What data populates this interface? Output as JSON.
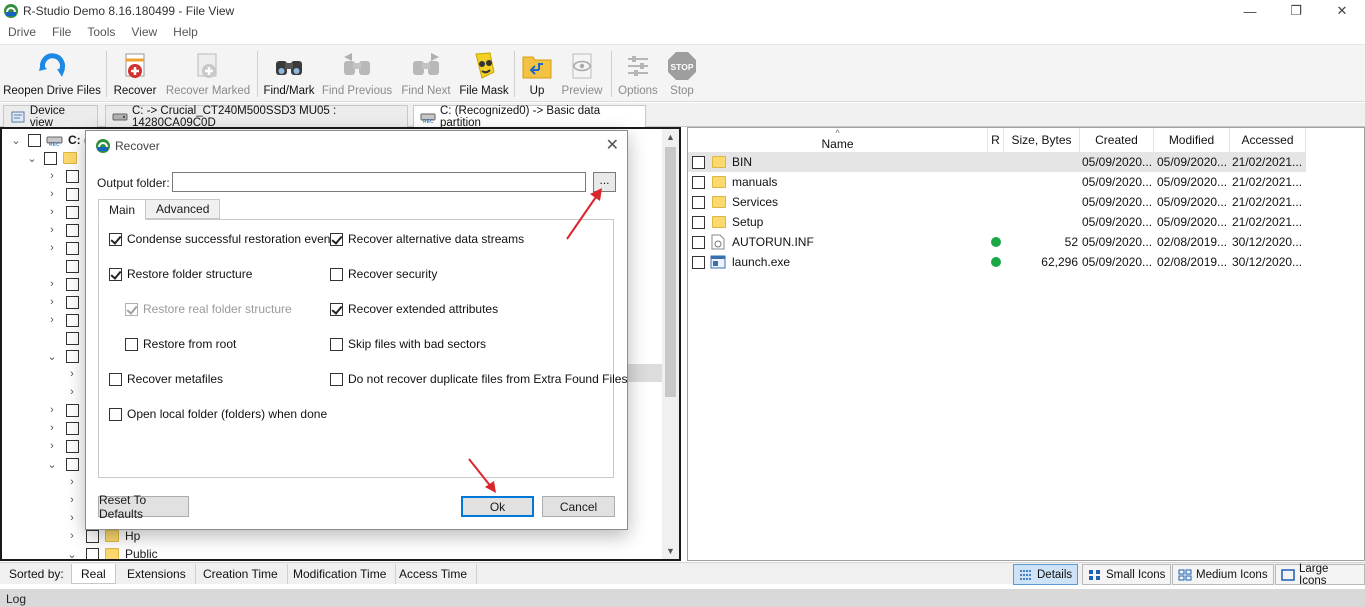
{
  "window": {
    "title": "R-Studio Demo 8.16.180499 - File View",
    "minimize_glyph": "—",
    "maximize_glyph": "❐",
    "close_glyph": "✕"
  },
  "menu": [
    "Drive",
    "File",
    "Tools",
    "View",
    "Help"
  ],
  "toolbar": {
    "reopen": "Reopen Drive Files",
    "recover": "Recover",
    "recover_marked": "Recover Marked",
    "find_mark": "Find/Mark",
    "find_previous": "Find Previous",
    "find_next": "Find Next",
    "file_mask": "File Mask",
    "up": "Up",
    "preview": "Preview",
    "options": "Options",
    "stop": "Stop",
    "stop_icon_text": "STOP"
  },
  "path_tabs": {
    "device_view": "Device view",
    "drive": "C: -> Crucial_CT240M500SSD3 MU05 : 14280CA09C0D",
    "partition": "C: (Recognized0) -> Basic data partition"
  },
  "tree": {
    "root_label": "C: (",
    "items": [
      {
        "label": "Hp"
      },
      {
        "label": "Public"
      }
    ]
  },
  "file_list": {
    "columns": {
      "name": "Name",
      "r": "R",
      "size": "Size, Bytes",
      "created": "Created",
      "modified": "Modified",
      "accessed": "Accessed",
      "sort_glyph": "^"
    },
    "rows": [
      {
        "name": "BIN",
        "type": "folder",
        "r": false,
        "size": "",
        "created": "05/09/2020...",
        "modified": "05/09/2020...",
        "accessed": "21/02/2021..."
      },
      {
        "name": "manuals",
        "type": "folder",
        "r": false,
        "size": "",
        "created": "05/09/2020...",
        "modified": "05/09/2020...",
        "accessed": "21/02/2021..."
      },
      {
        "name": "Services",
        "type": "folder",
        "r": false,
        "size": "",
        "created": "05/09/2020...",
        "modified": "05/09/2020...",
        "accessed": "21/02/2021..."
      },
      {
        "name": "Setup",
        "type": "folder",
        "r": false,
        "size": "",
        "created": "05/09/2020...",
        "modified": "05/09/2020...",
        "accessed": "21/02/2021..."
      },
      {
        "name": "AUTORUN.INF",
        "type": "file",
        "r": true,
        "size": "52",
        "created": "05/09/2020...",
        "modified": "02/08/2019...",
        "accessed": "30/12/2020..."
      },
      {
        "name": "launch.exe",
        "type": "exe",
        "r": true,
        "size": "62,296",
        "created": "05/09/2020...",
        "modified": "02/08/2019...",
        "accessed": "30/12/2020..."
      }
    ]
  },
  "sortbar": {
    "label": "Sorted by:",
    "tabs": [
      "Real",
      "Extensions",
      "Creation Time",
      "Modification Time",
      "Access Time"
    ]
  },
  "view_buttons": {
    "details": "Details",
    "small_icons": "Small Icons",
    "medium_icons": "Medium Icons",
    "large_icons": "Large Icons"
  },
  "log": {
    "label": "Log"
  },
  "dialog": {
    "title": "Recover",
    "output_label": "Output folder:",
    "output_value": "",
    "browse_label": "...",
    "tabs": [
      "Main",
      "Advanced"
    ],
    "options_left": [
      {
        "label": "Condense successful restoration events",
        "checked": true,
        "disabled": false
      },
      {
        "label": "Restore folder structure",
        "checked": true,
        "disabled": false
      },
      {
        "label": "Restore real folder structure",
        "checked": true,
        "disabled": true
      },
      {
        "label": "Restore from root",
        "checked": false,
        "disabled": false
      },
      {
        "label": "Recover metafiles",
        "checked": false,
        "disabled": false
      },
      {
        "label": "Open local folder (folders) when done",
        "checked": false,
        "disabled": false
      }
    ],
    "options_right": [
      {
        "label": "Recover alternative data streams",
        "checked": true
      },
      {
        "label": "Recover security",
        "checked": false
      },
      {
        "label": "Recover extended attributes",
        "checked": true
      },
      {
        "label": "Skip files with bad sectors",
        "checked": false
      },
      {
        "label": "Do not recover duplicate files from Extra Found Files",
        "checked": false
      }
    ],
    "reset_label": "Reset To Defaults",
    "ok_label": "Ok",
    "cancel_label": "Cancel"
  },
  "colors": {
    "annotation_arrow": "#d9262c",
    "ok_focus": "#0078d7",
    "status_dot": "#1aa845",
    "folder": "#fbd96e"
  }
}
